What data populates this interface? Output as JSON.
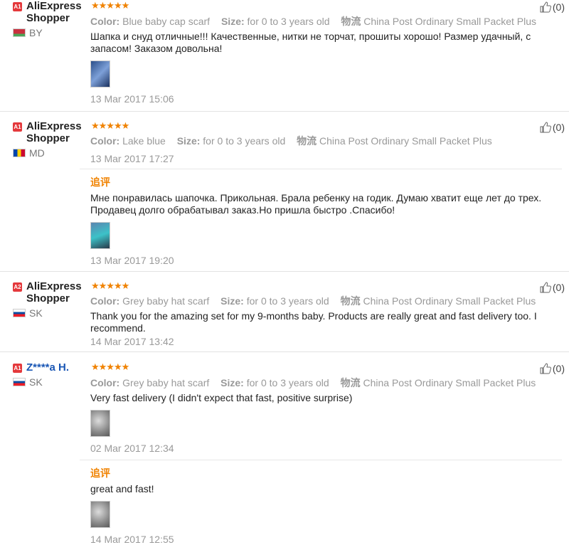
{
  "reviews": [
    {
      "level": "A1",
      "name": "AliExpress Shopper",
      "country": "BY",
      "stars": "★★★★★",
      "helpful": "(0)",
      "color_label": "Color:",
      "color": "Blue baby cap scarf",
      "size_label": "Size:",
      "size": "for 0 to 3 years old",
      "logistics_label": "物流",
      "logistics": "China Post Ordinary Small Packet Plus",
      "text": "Шапка и снуд отличные!!! Качественные, нитки не торчат, прошиты хорошо! Размер удачный, с запасом! Заказом довольна!",
      "date": "13 Mar 2017 15:06"
    },
    {
      "level": "A1",
      "name": "AliExpress Shopper",
      "country": "MD",
      "stars": "★★★★★",
      "helpful": "(0)",
      "color_label": "Color:",
      "color": "Lake blue",
      "size_label": "Size:",
      "size": "for 0 to 3 years old",
      "logistics_label": "物流",
      "logistics": "China Post Ordinary Small Packet Plus",
      "date": "13 Mar 2017 17:27",
      "followup": {
        "label": "追评",
        "text": "Мне понравилась шапочка. Прикольная. Брала ребенку на годик. Думаю хватит еще лет до трех. Продавец долго обрабатывал заказ.Но пришла быстро .Спасибо!",
        "date": "13 Mar 2017 19:20"
      }
    },
    {
      "level": "A2",
      "name": "AliExpress Shopper",
      "country": "SK",
      "stars": "★★★★★",
      "helpful": "(0)",
      "color_label": "Color:",
      "color": "Grey baby hat scarf",
      "size_label": "Size:",
      "size": "for 0 to 3 years old",
      "logistics_label": "物流",
      "logistics": "China Post Ordinary Small Packet Plus",
      "text": "Thank you for the amazing set for my 9-months baby. Products are really great and fast delivery too. I recommend.",
      "date": "14 Mar 2017 13:42"
    },
    {
      "level": "A1",
      "name": "Z****a H.",
      "country": "SK",
      "stars": "★★★★★",
      "helpful": "(0)",
      "color_label": "Color:",
      "color": "Grey baby hat scarf",
      "size_label": "Size:",
      "size": "for 0 to 3 years old",
      "logistics_label": "物流",
      "logistics": "China Post Ordinary Small Packet Plus",
      "text": "Very fast delivery (I didn't expect that fast, positive surprise)",
      "date": "02 Mar 2017 12:34",
      "followup": {
        "label": "追评",
        "text": "great and fast!",
        "date": "14 Mar 2017 12:55"
      }
    }
  ],
  "colors": {
    "star": "#f08200",
    "badge": "#e4393c",
    "link_name": "#1a57b5"
  },
  "icons": {
    "helpful": "thumb-up-icon",
    "flag": "flag-icon",
    "level": "level-badge-icon"
  }
}
